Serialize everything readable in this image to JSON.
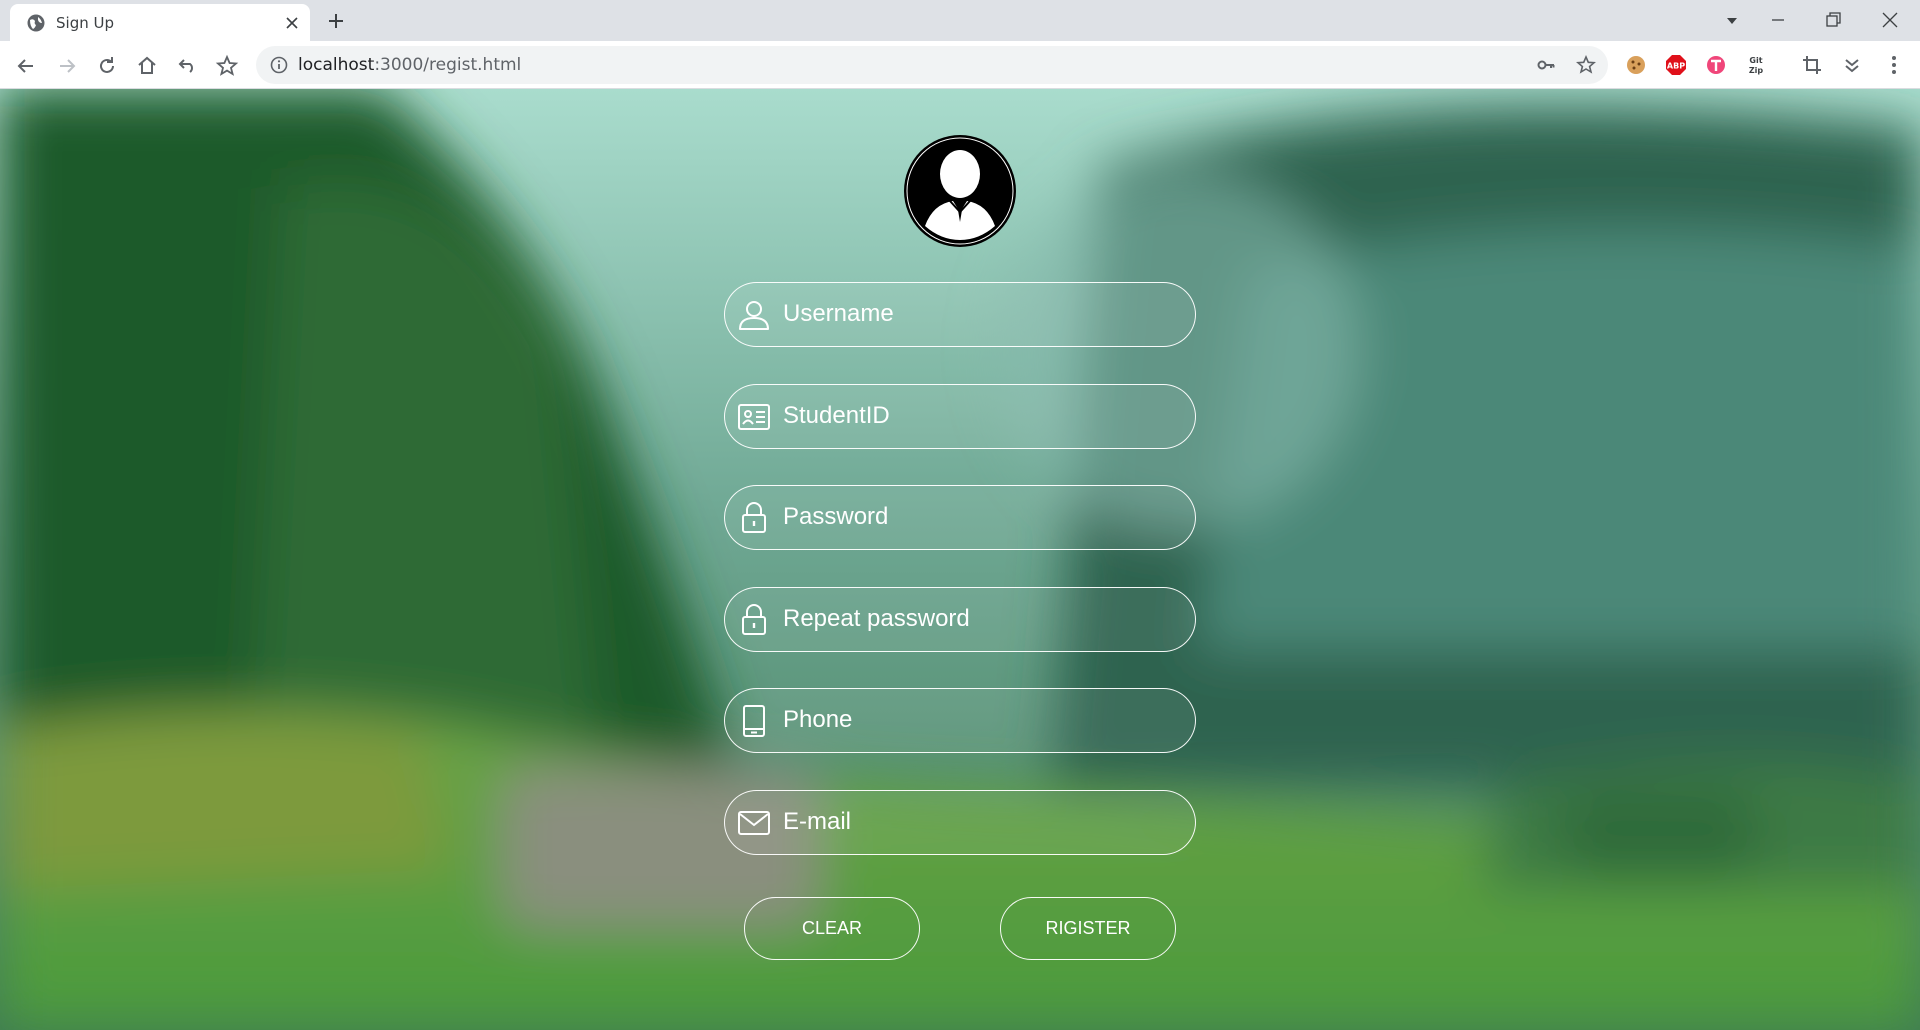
{
  "browser": {
    "tab_title": "Sign Up",
    "url_host": "localhost",
    "url_path": ":3000/regist.html"
  },
  "form": {
    "username_placeholder": "Username",
    "studentid_placeholder": "StudentID",
    "password_placeholder": "Password",
    "repeat_password_placeholder": "Repeat password",
    "phone_placeholder": "Phone",
    "email_placeholder": "E-mail",
    "clear_label": "CLEAR",
    "register_label": "RIGISTER"
  },
  "icons": {
    "favicon": "globe-icon",
    "username": "user-icon",
    "studentid": "id-card-icon",
    "password": "lock-icon",
    "repeat_password": "lock-icon",
    "phone": "tablet-icon",
    "email": "mail-icon"
  },
  "colors": {
    "field_border": "#ffffff",
    "text": "#ffffff",
    "tabbar": "#dee1e6"
  }
}
